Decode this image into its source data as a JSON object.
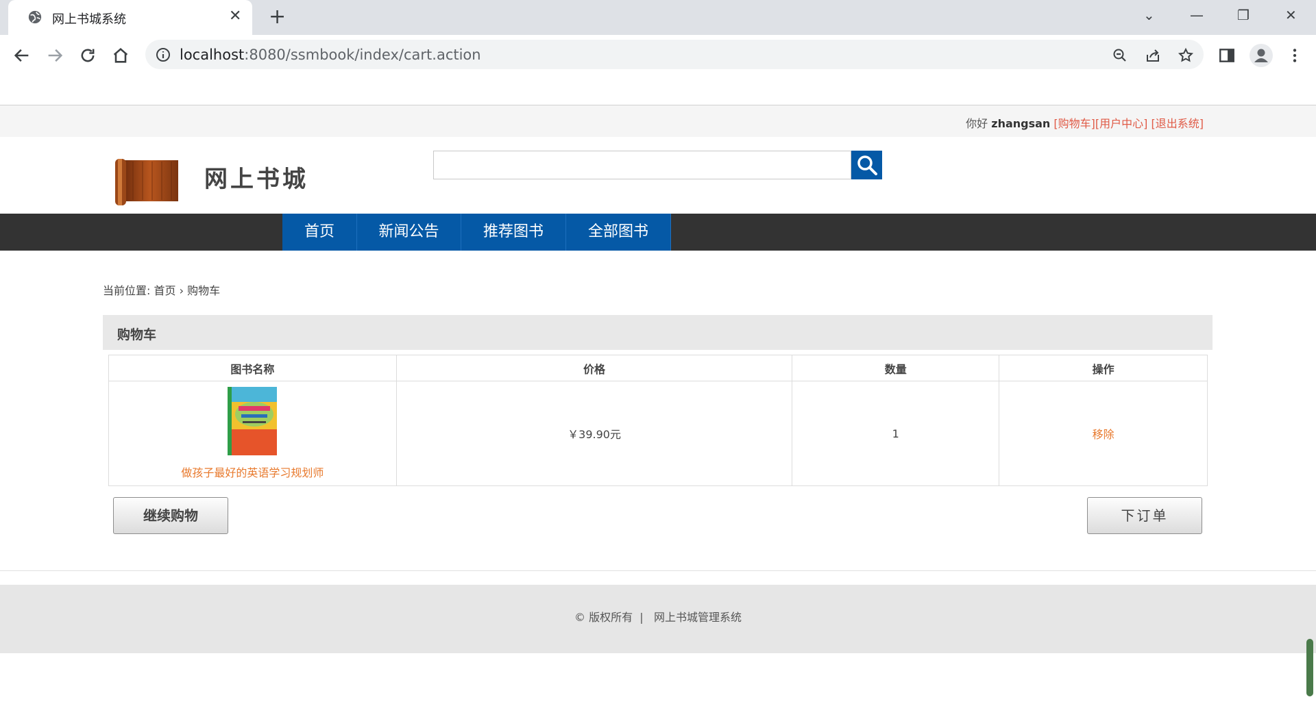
{
  "browser": {
    "tab_title": "网上书城系统",
    "tab_close": "✕",
    "new_tab": "+",
    "url_host": "localhost",
    "url_rest": ":8080/ssmbook/index/cart.action",
    "window_controls": [
      "⌄",
      "—",
      "❐",
      "✕"
    ]
  },
  "topbar": {
    "greeting": "你好",
    "username": "zhangsan",
    "links": [
      "[购物车]",
      "[用户中心]",
      "[退出系统]"
    ]
  },
  "header": {
    "site_name": "网上书城",
    "search_placeholder": ""
  },
  "nav": {
    "items": [
      "首页",
      "新闻公告",
      "推荐图书",
      "全部图书"
    ]
  },
  "breadcrumb": {
    "prefix": "当前位置:",
    "home": "首页",
    "separator": "›",
    "current": "购物车"
  },
  "cart": {
    "title": "购物车",
    "columns": [
      "图书名称",
      "价格",
      "数量",
      "操作"
    ],
    "rows": [
      {
        "book_name": "做孩子最好的英语学习规划师",
        "price": "￥39.90元",
        "quantity": "1",
        "action": "移除"
      }
    ],
    "continue_label": "继续购物",
    "order_label": "下订单"
  },
  "footer": {
    "copyright": "© 版权所有  |   网上书城管理系统"
  },
  "colors": {
    "brand_blue": "#0559a6",
    "nav_bg": "#333333",
    "link_red": "#e05a46",
    "link_orange": "#e87a2e"
  }
}
